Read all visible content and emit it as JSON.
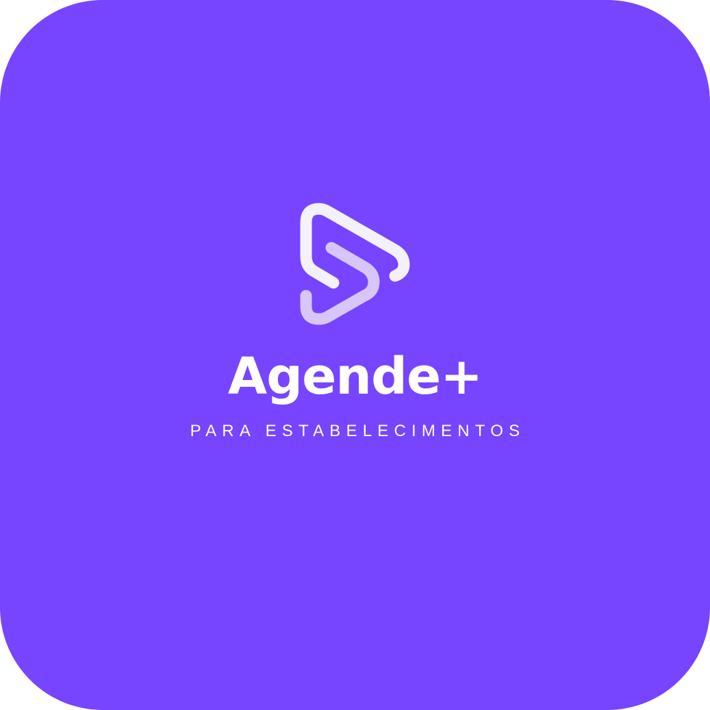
{
  "colors": {
    "background": "#7744ff",
    "brand_text": "#ffffff",
    "mark_primary": "#f3f1fa",
    "mark_secondary": "#d8c6fb"
  },
  "logo": {
    "icon": "play-s-logo-icon"
  },
  "brand": {
    "name": "Agende+",
    "tagline": "PARA ESTABELECIMENTOS"
  }
}
